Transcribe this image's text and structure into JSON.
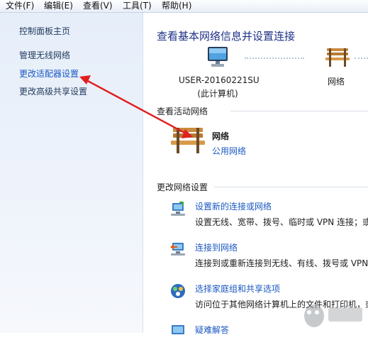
{
  "menu": [
    "文件(F)",
    "编辑(E)",
    "查看(V)",
    "工具(T)",
    "帮助(H)"
  ],
  "sidebar": {
    "home": "控制面板主页",
    "links": [
      "管理无线网络",
      "更改适配器设置",
      "更改高级共享设置"
    ]
  },
  "main": {
    "title": "查看基本网络信息并设置连接",
    "map": {
      "computer_name": "USER-20160221SU",
      "computer_sub": "(此计算机)",
      "network": "网络"
    },
    "active_header": "查看活动网络",
    "active_network": {
      "name": "网络",
      "type": "公用网络"
    },
    "change_header": "更改网络设置",
    "tasks": [
      {
        "title": "设置新的连接或网络",
        "desc": "设置无线、宽带、拨号、临时或 VPN 连接；或"
      },
      {
        "title": "连接到网络",
        "desc": "连接到或重新连接到无线、有线、拨号或 VPN"
      },
      {
        "title": "选择家庭组和共享选项",
        "desc": "访问位于其他网络计算机上的文件和打印机，或"
      },
      {
        "title": "疑难解答",
        "desc": ""
      }
    ]
  },
  "colors": {
    "link": "#1a58c2",
    "title": "#1e3287",
    "annotation_arrow": "#e02020"
  }
}
